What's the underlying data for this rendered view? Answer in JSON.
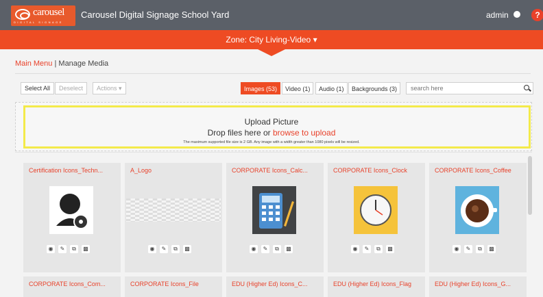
{
  "header": {
    "logo_word": "carousel",
    "logo_tag": "DIGITAL SIGNAGE",
    "app_title": "Carousel Digital Signage School Yard",
    "user": "admin",
    "help_label": "?"
  },
  "zone": {
    "label": "Zone: City Living-Video ▾"
  },
  "breadcrumb": {
    "main": "Main Menu",
    "sep": " | ",
    "current": "Manage Media"
  },
  "toolbar": {
    "select_all": "Select All",
    "deselect": "Deselect",
    "actions": "Actions ▾",
    "tabs": [
      "Images (53)",
      "Video (1)",
      "Audio (1)",
      "Backgrounds (3)"
    ],
    "search_placeholder": "search here"
  },
  "upload": {
    "title": "Upload Picture",
    "drop_text": "Drop files here or ",
    "browse_link": "browse to upload",
    "note": "The maximum supported file size is 2 GB. Any image with a width greater than 1080 pixels will be resized."
  },
  "cards": [
    {
      "name": "Certification Icons_Techn...",
      "icon": "technician-icon"
    },
    {
      "name": "A_Logo",
      "icon": "logo-thumbnail"
    },
    {
      "name": "CORPORATE Icons_Calc...",
      "icon": "calculator-icon"
    },
    {
      "name": "CORPORATE Icons_Clock",
      "icon": "clock-icon"
    },
    {
      "name": "CORPORATE Icons_Coffee",
      "icon": "coffee-icon"
    }
  ],
  "cards_row2": [
    {
      "name": "CORPORATE Icons_Com..."
    },
    {
      "name": "CORPORATE Icons_File"
    },
    {
      "name": "EDU (Higher Ed) Icons_C..."
    },
    {
      "name": "EDU (Higher Ed) Icons_Flag"
    },
    {
      "name": "EDU (Higher Ed) Icons_G..."
    }
  ],
  "card_actions": [
    "view-icon",
    "edit-icon",
    "copy-icon",
    "delete-icon"
  ],
  "colors": {
    "accent": "#ee4b23",
    "header": "#5b6068",
    "highlight": "#f3ea4a"
  }
}
